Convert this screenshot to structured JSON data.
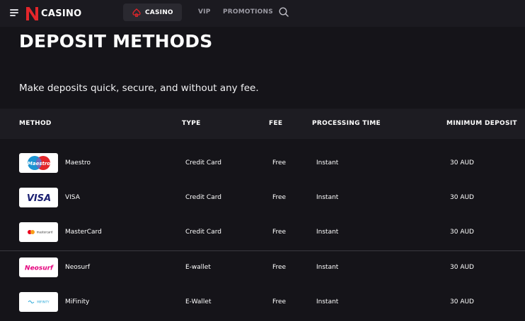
{
  "header": {
    "brand": "CASINO",
    "nav": [
      {
        "label": "CASINO",
        "active": true
      },
      {
        "label": "VIP"
      },
      {
        "label": "PROMOTIONS"
      }
    ]
  },
  "page": {
    "title": "DEPOSIT METHODS",
    "subtitle": "Make deposits quick, secure, and without any fee."
  },
  "table": {
    "columns": [
      "METHOD",
      "TYPE",
      "FEE",
      "PROCESSING TIME",
      "MINIMUM DEPOSIT"
    ],
    "rows": [
      {
        "method": "Maestro",
        "type": "Credit Card",
        "fee": "Free",
        "time": "Instant",
        "min": "30 AUD",
        "logo": "maestro-logo",
        "logo_text": "Maestro"
      },
      {
        "method": "VISA",
        "type": "Credit Card",
        "fee": "Free",
        "time": "Instant",
        "min": "30 AUD",
        "logo": "visa-logo",
        "logo_text": "VISA"
      },
      {
        "method": "MasterCard",
        "type": "Credit Card",
        "fee": "Free",
        "time": "Instant",
        "min": "30 AUD",
        "logo": "mastercard-logo",
        "logo_text": "mastercard"
      },
      {
        "method": "Neosurf",
        "type": "E-wallet",
        "fee": "Free",
        "time": "Instant",
        "min": "30 AUD",
        "logo": "neosurf-logo",
        "logo_text": "Neosurf"
      },
      {
        "method": "MiFinity",
        "type": "E-Wallet",
        "fee": "Free",
        "time": "Instant",
        "min": "30 AUD",
        "logo": "mifinity-logo",
        "logo_text": "MIFINITY"
      }
    ]
  },
  "colors": {
    "background": "#151419",
    "topbar": "#1b1a20",
    "table_header": "#1d1c22",
    "brand_red": "#e3262b",
    "nav_inactive": "#9b9aa3"
  },
  "icons": [
    "menu-icon",
    "logo-n-icon",
    "spade-icon",
    "search-icon"
  ]
}
